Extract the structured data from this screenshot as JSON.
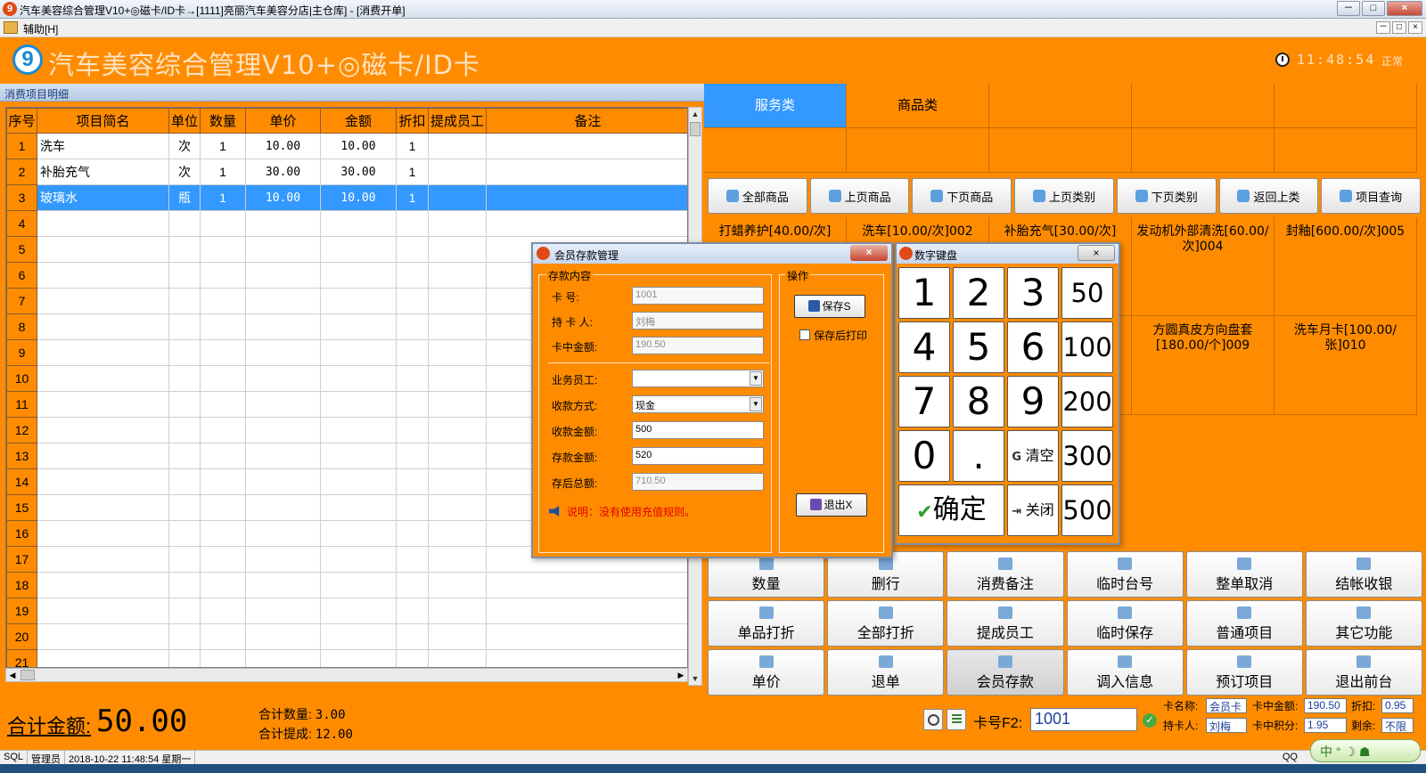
{
  "window": {
    "title": "汽车美容综合管理V10+◎磁卡/ID卡→[1111]亮丽汽车美容分店|主仓库] - [消费开单]",
    "app_icon": "9",
    "controls": [
      "－",
      "□",
      "×"
    ]
  },
  "menu": {
    "items": [
      "辅助[H]"
    ],
    "mdi_controls": [
      "－",
      "□",
      "×"
    ]
  },
  "header": {
    "logo": "9",
    "app_title": "汽车美容综合管理V10+◎磁卡/ID卡",
    "time": "11:48:54",
    "status": "正常"
  },
  "consumption": {
    "caption": "消费项目明细",
    "columns": [
      "序号",
      "项目简名",
      "单位",
      "数量",
      "单价",
      "金额",
      "折扣",
      "提成员工",
      "备注"
    ],
    "rows": [
      {
        "no": "1",
        "name": "洗车",
        "unit": "次",
        "qty": "1",
        "price": "10.00",
        "amount": "10.00",
        "discount": "1",
        "staff": "",
        "note": ""
      },
      {
        "no": "2",
        "name": "补胎充气",
        "unit": "次",
        "qty": "1",
        "price": "30.00",
        "amount": "30.00",
        "discount": "1",
        "staff": "",
        "note": ""
      },
      {
        "no": "3",
        "name": "玻璃水",
        "unit": "瓶",
        "qty": "1",
        "price": "10.00",
        "amount": "10.00",
        "discount": "1",
        "staff": "",
        "note": ""
      },
      {
        "no": "4"
      },
      {
        "no": "5"
      },
      {
        "no": "6"
      },
      {
        "no": "7"
      },
      {
        "no": "8"
      },
      {
        "no": "9"
      },
      {
        "no": "10"
      },
      {
        "no": "11"
      },
      {
        "no": "12"
      },
      {
        "no": "13"
      },
      {
        "no": "14"
      },
      {
        "no": "15"
      },
      {
        "no": "16"
      },
      {
        "no": "17"
      },
      {
        "no": "18"
      },
      {
        "no": "19"
      },
      {
        "no": "20"
      },
      {
        "no": "21"
      }
    ],
    "selected_row": 3
  },
  "categories": {
    "tabs": [
      "服务类",
      "商品类",
      "",
      "",
      "",
      "",
      "",
      "",
      "",
      ""
    ],
    "active": 0
  },
  "nav_buttons": [
    "全部商品",
    "上页商品",
    "下页商品",
    "上页类别",
    "下页类别",
    "返回上类",
    "项目查询"
  ],
  "products": [
    "打蜡养护[40.00/次]",
    "洗车[10.00/次]002",
    "补胎充气[30.00/次]",
    "发动机外部清洗[60.00/次]004",
    "封釉[600.00/次]005",
    "",
    "",
    "",
    "方圆真皮方向盘套[180.00/个]009",
    "洗车月卡[100.00/张]010"
  ],
  "functions": [
    [
      "数量",
      "删行",
      "消费备注",
      "临时台号",
      "整单取消",
      "结帐收银"
    ],
    [
      "单品打折",
      "全部打折",
      "提成员工",
      "临时保存",
      "普通项目",
      "其它功能"
    ],
    [
      "单价",
      "退单",
      "会员存款",
      "调入信息",
      "预订项目",
      "退出前台"
    ]
  ],
  "totals": {
    "amount_label": "合计金额:",
    "amount_value": "50.00",
    "qty_label": "合计数量:",
    "qty_value": "3.00",
    "commission_label": "合计提成:",
    "commission_value": "12.00"
  },
  "card": {
    "label": "卡号F2:",
    "number": "1001",
    "name_label": "卡名称:",
    "name_value": "会员卡",
    "balance_label": "卡中金额:",
    "balance_value": "190.50",
    "discount_label": "折扣:",
    "discount_value": "0.95",
    "holder_label": "持卡人:",
    "holder_value": "刘梅",
    "points_label": "卡中积分:",
    "points_value": "1.95",
    "remain_label": "剩余:",
    "remain_value": "不限"
  },
  "statusbar": {
    "items": [
      "SQL",
      "管理员",
      "2018-10-22 11:48:54 星期一"
    ],
    "right": "QQ"
  },
  "ime": "中 ° ☽ ☗",
  "deposit_dialog": {
    "title": "会员存款管理",
    "close": "×",
    "group_title": "存款内容",
    "ops_title": "操作",
    "card_no_label": "卡    号:",
    "card_no": "1001",
    "holder_label": "持 卡 人:",
    "holder": "刘梅",
    "balance_label": "卡中金额:",
    "balance": "190.50",
    "staff_label": "业务员工:",
    "staff": "",
    "pay_method_label": "收款方式:",
    "pay_method": "现金",
    "received_label": "收款金额:",
    "received": "500",
    "deposit_label": "存款金额:",
    "deposit": "520",
    "after_label": "存后总额:",
    "after": "710.50",
    "note": "说明：没有使用充值规则。",
    "save_label": "保存S",
    "print_after_save": "保存后打印",
    "exit_label": "退出X"
  },
  "keypad": {
    "title": "数字键盘",
    "close": "×",
    "keys": [
      "1",
      "2",
      "3",
      "50",
      "4",
      "5",
      "6",
      "100",
      "7",
      "8",
      "9",
      "200",
      "0",
      ".",
      "清空",
      "300",
      "确定",
      "关闭",
      "500"
    ]
  }
}
